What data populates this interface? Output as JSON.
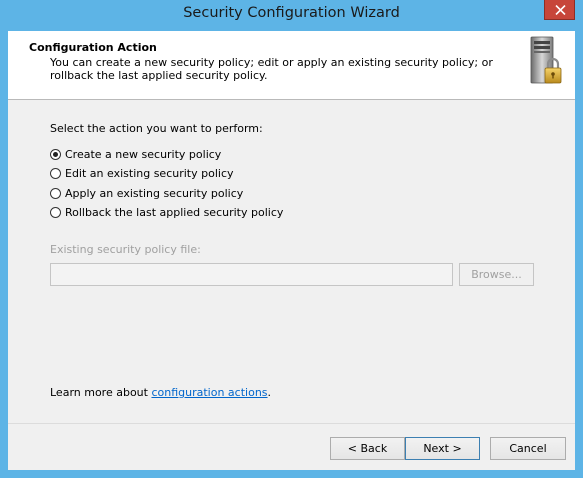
{
  "window": {
    "title": "Security Configuration Wizard"
  },
  "header": {
    "title": "Configuration Action",
    "description": "You can create a new security policy; edit or apply an existing security policy; or rollback the last applied security policy.",
    "icon": "server-lock-icon"
  },
  "body": {
    "prompt": "Select the action you want to perform:",
    "options": [
      {
        "label": "Create a new security policy",
        "checked": true
      },
      {
        "label": "Edit an existing security policy",
        "checked": false
      },
      {
        "label": "Apply an existing security policy",
        "checked": false
      },
      {
        "label": "Rollback the last applied security policy",
        "checked": false
      }
    ],
    "file_label": "Existing security policy file:",
    "file_value": "",
    "browse_label": "Browse...",
    "learn_more_prefix": "Learn more about ",
    "learn_more_link": "configuration actions",
    "learn_more_suffix": "."
  },
  "footer": {
    "back_label": "< Back",
    "next_label": "Next >",
    "cancel_label": "Cancel"
  },
  "colors": {
    "frame": "#5db4e6",
    "close": "#c7463a",
    "link": "#0066cc",
    "disabled_text": "#a0a0a0"
  }
}
